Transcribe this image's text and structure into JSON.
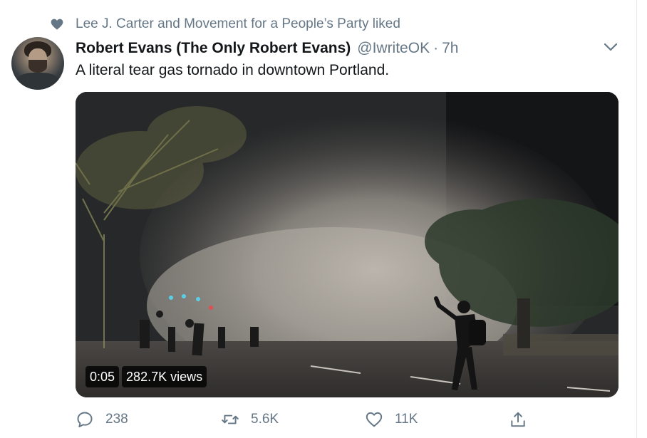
{
  "social_context": {
    "text": "Lee J. Carter and Movement for a People’s Party liked",
    "icon": "heart-icon"
  },
  "tweet": {
    "author_name": "Robert Evans (The Only Robert Evans)",
    "author_handle": "@IwriteOK",
    "separator": "·",
    "time": "7h",
    "text": "A literal tear gas tornado in downtown Portland.",
    "video": {
      "duration": "0:05",
      "views": "282.7K views"
    }
  },
  "actions": {
    "reply_count": "238",
    "retweet_count": "5.6K",
    "like_count": "11K"
  },
  "colors": {
    "text_primary": "#14171a",
    "text_secondary": "#657786",
    "icon_gray": "#657786",
    "social_heart": "#657786"
  }
}
